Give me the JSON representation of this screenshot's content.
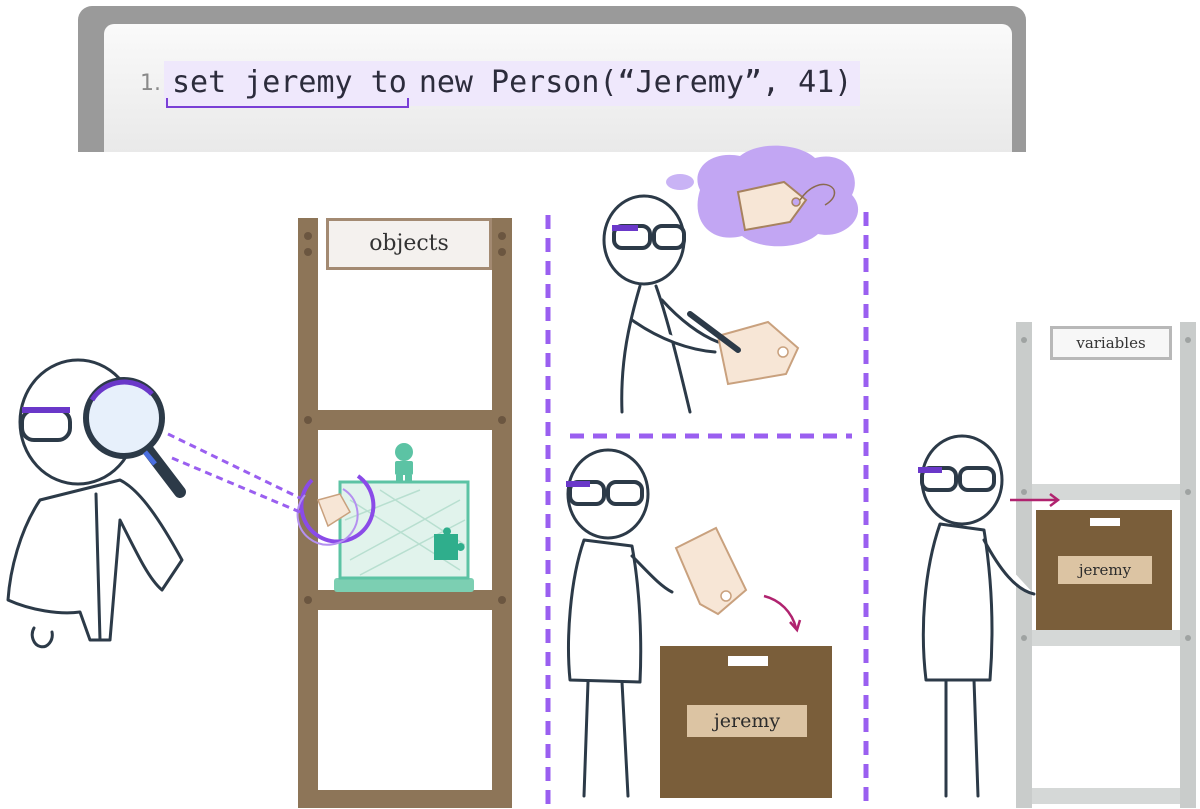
{
  "code": {
    "line_number": "1.",
    "assign_part": "set jeremy to",
    "expression_part": "new Person(“Jeremy”, 41)"
  },
  "labels": {
    "objects_sign": "objects",
    "variables_sign": "variables",
    "box_label_floor": "jeremy",
    "box_label_shelf": "jeremy"
  },
  "colors": {
    "accent_purple": "#8a4be8",
    "highlight_lavender": "#efe8fc",
    "wood_shelf": "#8d7558",
    "metal_shelf": "#c9cccb",
    "cardboard_box": "#7a5e3a",
    "tag_paper": "#f7e6d6",
    "object_teal": "#5cc3a4"
  }
}
